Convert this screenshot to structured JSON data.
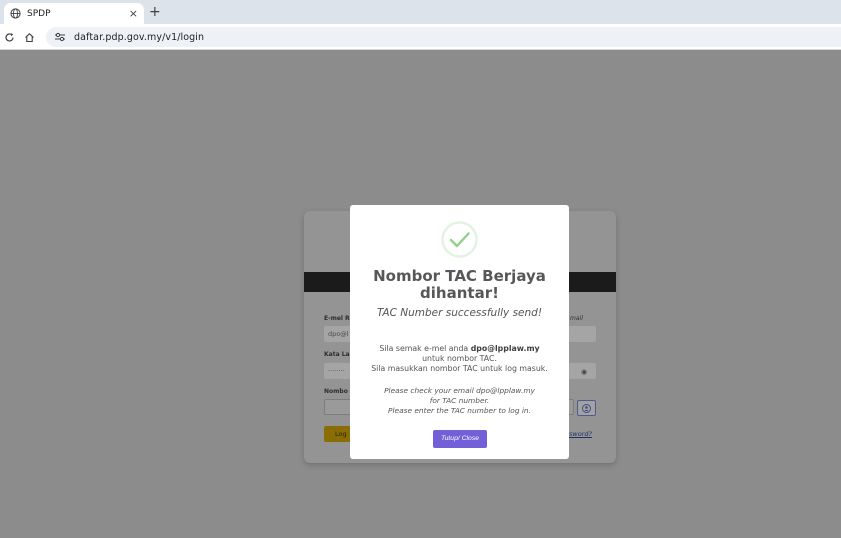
{
  "browser": {
    "tab_title": "SPDP",
    "tab_close": "×",
    "new_tab": "+",
    "url": "daftar.pdp.gov.my/v1/login"
  },
  "login_form": {
    "email_label": "E-mel R",
    "email_label_right": "mail",
    "email_value": "dpo@l",
    "password_label": "Kata La",
    "password_value": "········",
    "tac_label": "Nombo",
    "login_button": "Log",
    "forgot_link": "sword?"
  },
  "modal": {
    "title_line1": "Nombor TAC Berjaya",
    "title_line2": "dihantar!",
    "subtitle": "TAC Number successfully send!",
    "ms_line1_prefix": "Sila semak e-mel anda ",
    "ms_email": "dpo@lpplaw.my",
    "ms_line2": "untuk nombor TAC.",
    "ms_line3": "Sila masukkan nombor TAC untuk log masuk.",
    "en_line1": "Please check your email dpo@lpplaw.my",
    "en_line2": "for TAC number.",
    "en_line3": "Please enter the TAC number to log in.",
    "close_button": "Tutup/ Close"
  },
  "colors": {
    "accent_button": "#7360d9",
    "success_check": "#8fd18a",
    "overlay_background": "#8c8c8c"
  }
}
